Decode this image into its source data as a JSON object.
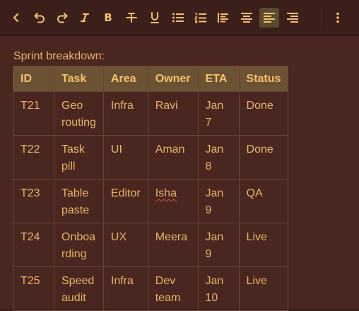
{
  "toolbar": {
    "buttons": [
      {
        "name": "collapse-chevron-icon"
      },
      {
        "name": "undo-icon"
      },
      {
        "name": "redo-icon"
      },
      {
        "name": "clear-format-icon"
      },
      {
        "name": "bold-icon",
        "label": "B"
      },
      {
        "name": "strikethrough-icon"
      },
      {
        "name": "underline-icon"
      },
      {
        "name": "bullet-list-icon"
      },
      {
        "name": "numbered-list-icon"
      },
      {
        "name": "align-left-block-icon"
      },
      {
        "name": "align-center-icon"
      },
      {
        "name": "align-left-icon",
        "active": true
      },
      {
        "name": "align-right-icon"
      },
      {
        "name": "more-vertical-icon"
      }
    ]
  },
  "editor": {
    "caption": "Sprint breakdown:",
    "table": {
      "headers": [
        "ID",
        "Task",
        "Area",
        "Owner",
        "ETA",
        "Status"
      ],
      "rows": [
        [
          "T21",
          "Geo routing",
          "Infra",
          "Ravi",
          "Jan 7",
          "Done"
        ],
        [
          "T22",
          "Task pill",
          "UI",
          "Aman",
          "Jan 8",
          "Done"
        ],
        [
          "T23",
          "Table paste",
          "Editor",
          "Isha",
          "Jan 9",
          "QA"
        ],
        [
          "T24",
          "Onboarding",
          "UX",
          "Meera",
          "Jan 9",
          "Live"
        ],
        [
          "T25",
          "Speed audit",
          "Infra",
          "Dev team",
          "Jan 10",
          "Live"
        ]
      ]
    }
  },
  "colors": {
    "background": "#3a1f1a",
    "editor": "#4a2620",
    "header_row": "#6a5232",
    "text": "#e6b566",
    "active_button": "#5a4a2e"
  }
}
